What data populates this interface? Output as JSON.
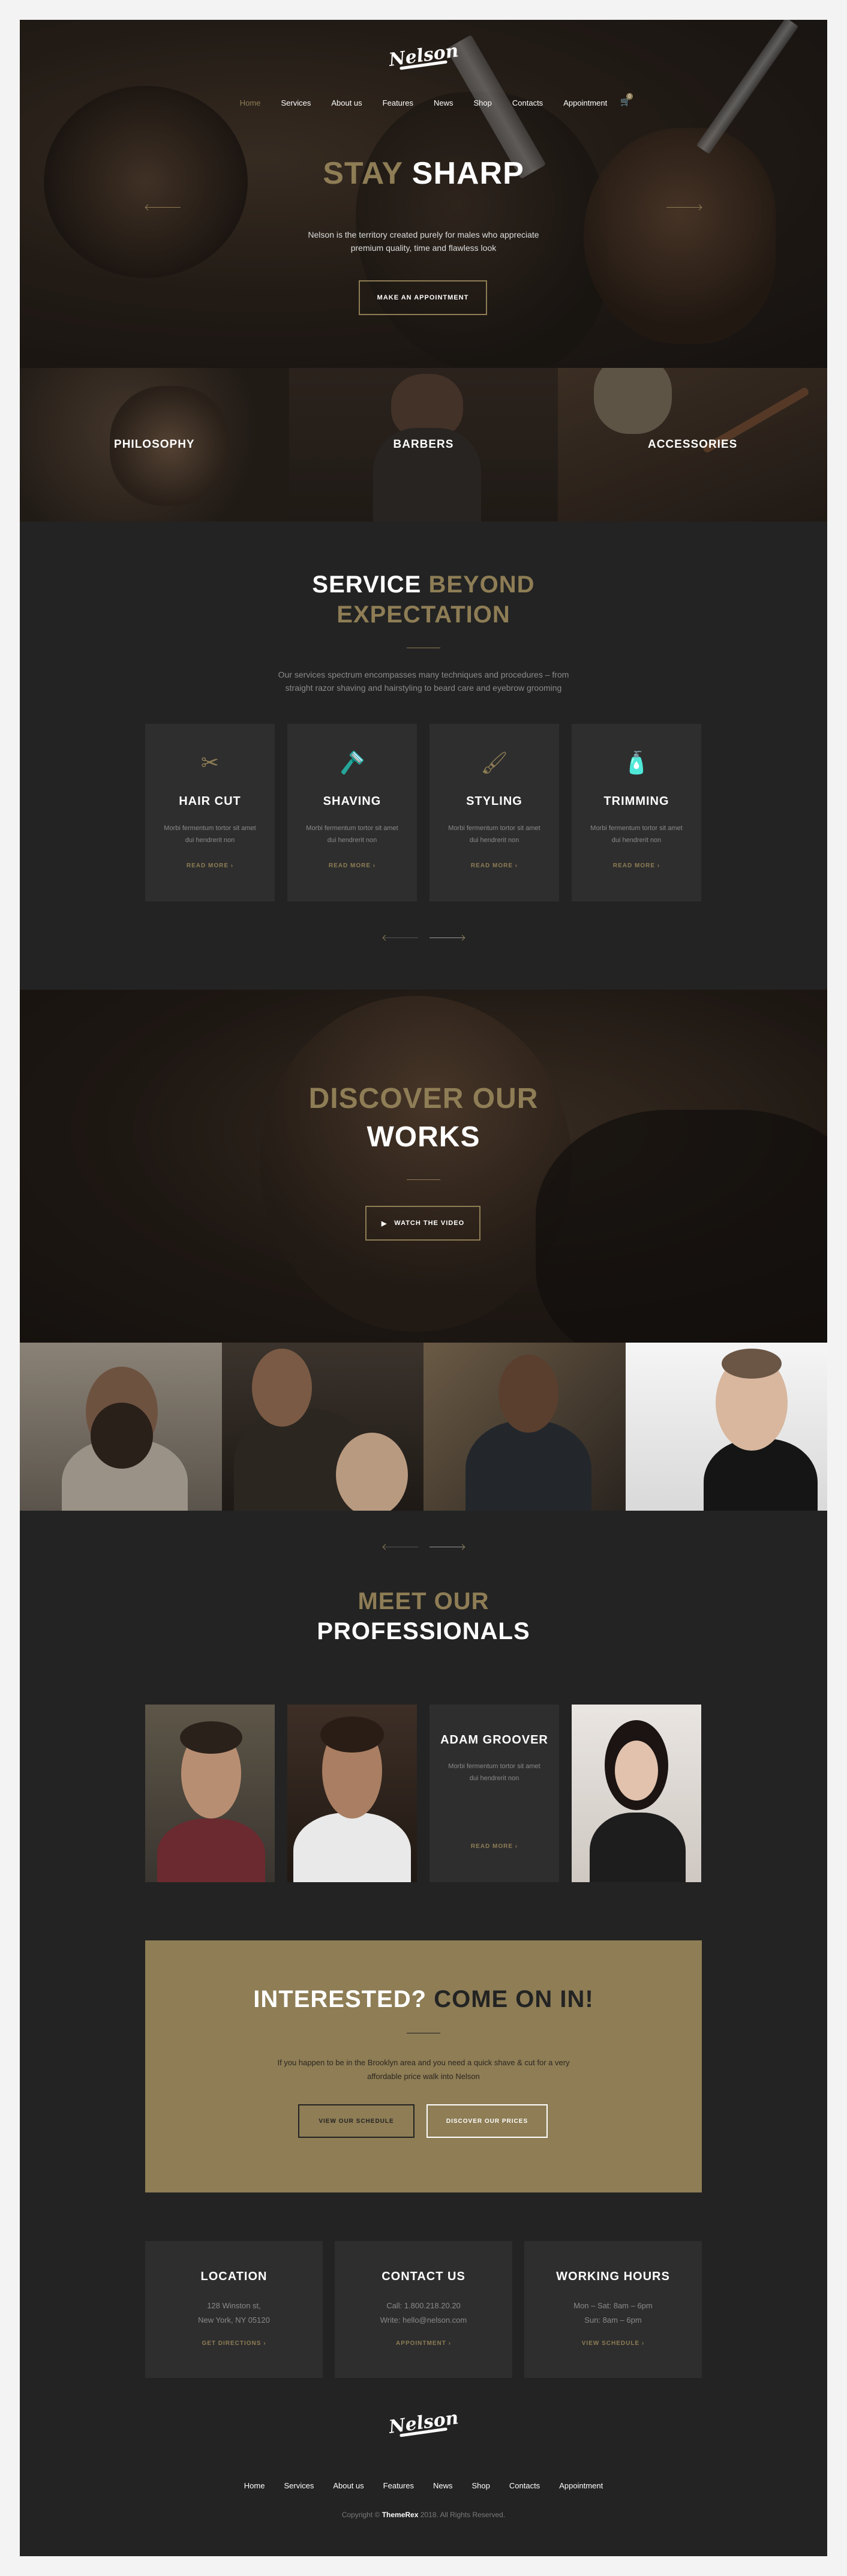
{
  "brand": {
    "logo": "Nelson"
  },
  "nav": {
    "items": [
      "Home",
      "Services",
      "About us",
      "Features",
      "News",
      "Shop",
      "Contacts",
      "Appointment"
    ],
    "cart_count": "0"
  },
  "hero": {
    "title_gold": "STAY",
    "title_white": "SHARP",
    "subtitle": "Nelson is the territory created purely for males who appreciate premium quality, time and flawless look",
    "button": "Make an appointment"
  },
  "categories": [
    "PHILOSOPHY",
    "BARBERS",
    "ACCESSORIES"
  ],
  "services": {
    "title_white": "SERVICE",
    "title_gold_1": "BEYOND",
    "title_gold_2": "EXPECTATION",
    "text": "Our services spectrum encompasses many techniques and procedures – from straight razor shaving and hairstyling to beard care and eyebrow grooming",
    "cards": [
      {
        "icon": "✂",
        "title": "HAIR CUT",
        "text": "Morbi fermentum tortor sit amet dui hendrerit non",
        "link": "READ MORE ›"
      },
      {
        "icon": "🪒",
        "title": "SHAVING",
        "text": "Morbi fermentum tortor sit amet dui hendrerit non",
        "link": "READ MORE ›"
      },
      {
        "icon": "🖌",
        "title": "STYLING",
        "text": "Morbi fermentum tortor sit amet dui hendrerit non",
        "link": "READ MORE ›"
      },
      {
        "icon": "🧴",
        "title": "TRIMMING",
        "text": "Morbi fermentum tortor sit amet dui hendrerit non",
        "link": "READ MORE ›"
      }
    ]
  },
  "discover": {
    "title_gold": "DISCOVER OUR",
    "title_white": "WORKS",
    "button": "Watch the video"
  },
  "team": {
    "title_gold": "MEET OUR",
    "title_white": "PROFESSIONALS",
    "member": {
      "name": "ADAM GROOVER",
      "text": "Morbi fermentum tortor sit amet dui hendrerit non",
      "link": "READ MORE ›"
    }
  },
  "cta": {
    "title_white": "INTERESTED?",
    "title_dark": "COME ON IN!",
    "text": "If you happen to be in the Brooklyn area and you need a quick shave & cut for a very affordable price walk into Nelson",
    "button_1": "View our schedule",
    "button_2": "Discover our prices"
  },
  "info": [
    {
      "title": "LOCATION",
      "line1": "128 Winston st,",
      "line2": "New York, NY 05120",
      "link": "GET DIRECTIONS ›"
    },
    {
      "title": "CONTACT US",
      "line1": "Call: 1.800.218.20.20",
      "line2": "Write: hello@nelson.com",
      "link": "APPOINTMENT ›"
    },
    {
      "title": "WORKING HOURS",
      "line1": "Mon – Sat: 8am – 6pm",
      "line2": "Sun: 8am – 6pm",
      "link": "VIEW SCHEDULE ›"
    }
  ],
  "footer": {
    "nav": [
      "Home",
      "Services",
      "About us",
      "Features",
      "News",
      "Shop",
      "Contacts",
      "Appointment"
    ],
    "copy_prefix": "Copyright ©",
    "copy_brand": "ThemeRex",
    "copy_suffix": "2018. All Rights Reserved."
  },
  "colors": {
    "accent": "#8e7d55",
    "background": "#232323",
    "card": "#2e2e2e"
  }
}
